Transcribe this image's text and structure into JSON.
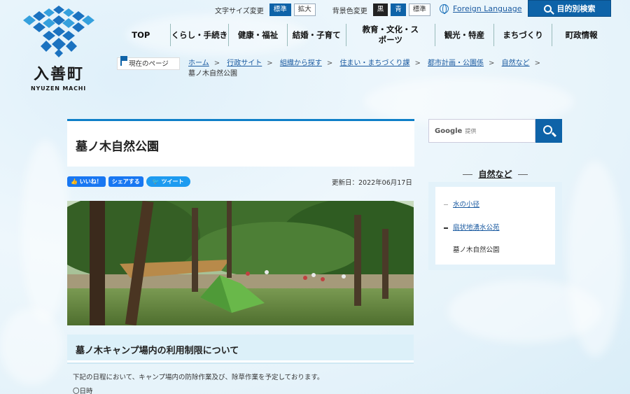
{
  "logo": {
    "name": "入善町",
    "roman": "NYUZEN MACHI"
  },
  "utility": {
    "font_size_label": "文字サイズ変更",
    "font_size_options": [
      "標準",
      "拡大"
    ],
    "bg_color_label": "背景色変更",
    "bg_color_options": [
      "黒",
      "青",
      "標準"
    ],
    "foreign_language": "Foreign Language",
    "purpose_search": "目的別検索"
  },
  "nav": [
    "TOP",
    "くらし・手続き",
    "健康・福祉",
    "結婚・子育て",
    "教育・文化・スポーツ",
    "観光・特産",
    "まちづくり",
    "町政情報"
  ],
  "breadcrumb": {
    "here_label": "現在のページ",
    "links": [
      "ホーム",
      "行政サイト",
      "組織から探す",
      "住まい・まちづくり課",
      "都市計画・公園係",
      "自然など"
    ],
    "current": "墓ノ木自然公園"
  },
  "page": {
    "title": "墓ノ木自然公園",
    "social": {
      "like": "いいね！",
      "share": "シェアする",
      "tweet": "ツイート"
    },
    "updated": "更新日：2022年06月17日",
    "section_title": "墓ノ木キャンプ場内の利用制限について",
    "body_line1": "下記の日程において、キャンプ場内の防除作業及び、除草作業を予定しております。",
    "body_line2": "〇日時"
  },
  "sidebar": {
    "search_brand": "Google",
    "search_placeholder": "提供",
    "section_title": "自然など",
    "items": [
      {
        "label": "水の小径",
        "link": true
      },
      {
        "label": "扇状地湧水公苑",
        "link": true
      },
      {
        "label": "墓ノ木自然公園",
        "link": false
      }
    ]
  },
  "colors": {
    "brand_blue": "#0e63a8",
    "accent_top": "#0e7fc8",
    "facebook": "#1877f2",
    "twitter": "#1d9bf0"
  }
}
